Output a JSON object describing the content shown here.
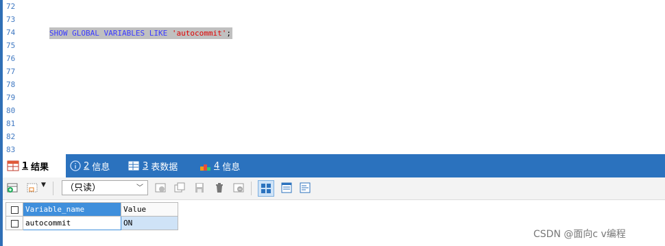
{
  "editor": {
    "line_numbers": [
      "72",
      "73",
      "74",
      "75",
      "76",
      "77",
      "78",
      "79",
      "80",
      "81",
      "82",
      "83"
    ],
    "code_line": {
      "kw1": "SHOW",
      "kw2": "GLOBAL",
      "kw3": "VARIABLES",
      "kw4": "LIKE",
      "string": "'autocommit'",
      "end": ";"
    }
  },
  "tabs": [
    {
      "num": "1",
      "label": "结果"
    },
    {
      "num": "2",
      "label": "信息"
    },
    {
      "num": "3",
      "label": "表数据"
    },
    {
      "num": "4",
      "label": "信息"
    }
  ],
  "toolbar": {
    "mode_select": "（只读）"
  },
  "results": {
    "columns": [
      "Variable_name",
      "Value"
    ],
    "rows": [
      [
        "autocommit",
        "ON"
      ]
    ]
  },
  "colors": {
    "accent": "#2b72be",
    "keyword": "#3a3aff",
    "string": "#e00000"
  },
  "watermark": "CSDN @面向c v编程"
}
